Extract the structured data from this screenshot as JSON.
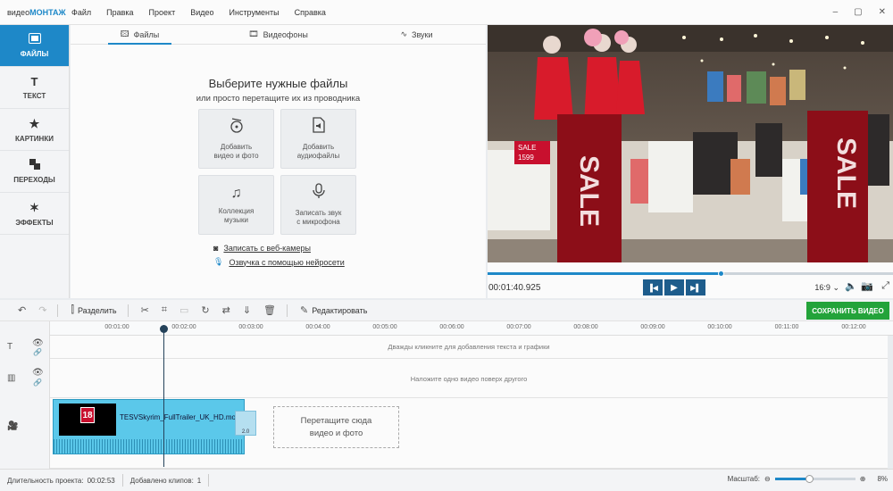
{
  "app": {
    "logo_part1": "видео",
    "logo_part2": "МОНТАЖ"
  },
  "menu": [
    "Файл",
    "Правка",
    "Проект",
    "Видео",
    "Инструменты",
    "Справка"
  ],
  "window_controls": [
    "–",
    "▢",
    "✕"
  ],
  "sidebar": [
    {
      "label": "ФАЙЛЫ",
      "icon": "files-icon",
      "active": true
    },
    {
      "label": "ТЕКСТ",
      "icon": "text-icon",
      "active": false
    },
    {
      "label": "КАРТИНКИ",
      "icon": "star-icon",
      "active": false
    },
    {
      "label": "ПЕРЕХОДЫ",
      "icon": "transitions-icon",
      "active": false
    },
    {
      "label": "ЭФФЕКТЫ",
      "icon": "magic-wand-icon",
      "active": false
    }
  ],
  "tabs": [
    {
      "label": "Файлы",
      "icon": "image-icon",
      "active": true
    },
    {
      "label": "Видеофоны",
      "icon": "film-icon",
      "active": false
    },
    {
      "label": "Звуки",
      "icon": "waveform-icon",
      "active": false
    }
  ],
  "files_panel": {
    "title": "Выберите нужные файлы",
    "subtitle": "или просто перетащите их из проводника",
    "tiles": [
      {
        "line1": "Добавить",
        "line2": "видео и фото",
        "icon": "film-reel-icon"
      },
      {
        "line1": "Добавить",
        "line2": "аудиофайлы",
        "icon": "audio-file-icon"
      },
      {
        "line1": "Коллекция",
        "line2": "музыки",
        "icon": "music-note-icon"
      },
      {
        "line1": "Записать звук",
        "line2": "с микрофона",
        "icon": "microphone-icon"
      }
    ],
    "links": [
      {
        "label": "Записать с веб-камеры",
        "icon": "webcam-icon"
      },
      {
        "label": "Озвучка с помощью нейросети",
        "icon": "mic-small-icon"
      }
    ]
  },
  "preview": {
    "timecode": "00:01:40.925",
    "progress": 0.578,
    "aspect_ratio": "16:9",
    "sale_text": "SALE",
    "tag_price": "1599"
  },
  "toolbar": {
    "split_label": "Разделить",
    "edit_label": "Редактировать",
    "save_label": "СОХРАНИТЬ ВИДЕО"
  },
  "timeline": {
    "ticks": [
      "00:01:00",
      "00:02:00",
      "00:03:00",
      "00:04:00",
      "00:05:00",
      "00:06:00",
      "00:07:00",
      "00:08:00",
      "00:09:00",
      "00:10:00",
      "00:11:00",
      "00:12:00"
    ],
    "text_track_hint": "Дважды кликните для добавления текста и графики",
    "overlay_track_hint": "Наложите одно видео поверх другого",
    "clip_name": "TESVSkyrim_FullTrailer_UK_HD.mov",
    "clip_badge": "18",
    "transition_label": "2.0",
    "drop_line1": "Перетащите сюда",
    "drop_line2": "видео и фото"
  },
  "status": {
    "duration_label": "Длительность проекта:",
    "duration_value": "00:02:53",
    "clips_label": "Добавлено клипов:",
    "clips_value": "1",
    "zoom_label": "Масштаб:",
    "zoom_value": "8%",
    "zoom_level": 0.42
  },
  "colors": {
    "accent": "#1e88c8",
    "save_button": "#23a33a",
    "clip": "#5bc8ea",
    "sale_red": "#c8102e"
  }
}
